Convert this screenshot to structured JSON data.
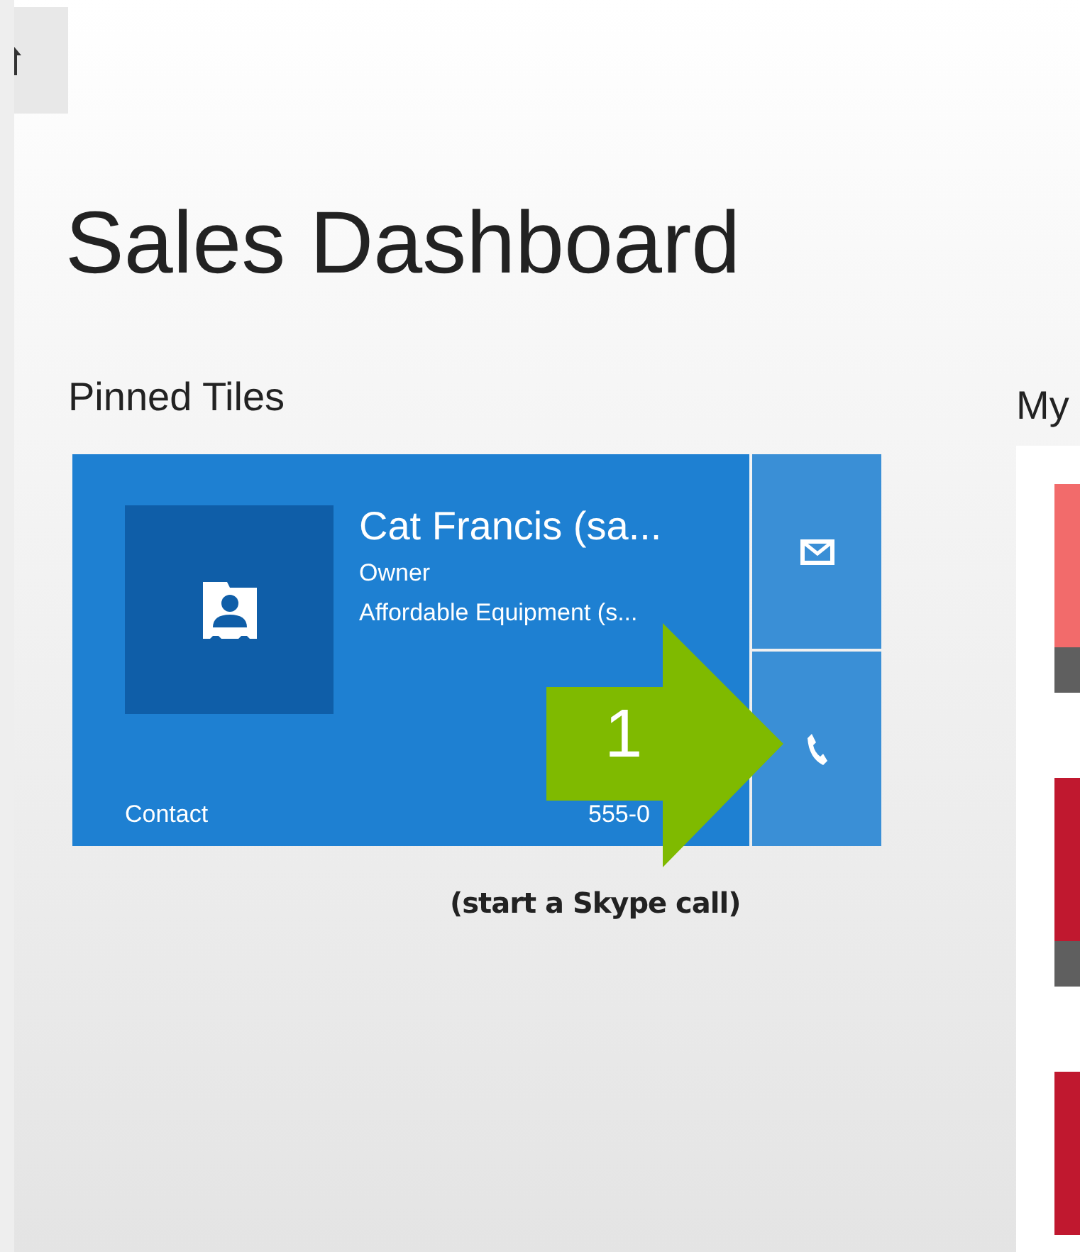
{
  "dashboard": {
    "title": "Sales Dashboard"
  },
  "pinned": {
    "heading": "Pinned Tiles",
    "tile": {
      "name": "Cat Francis (sa...",
      "role": "Owner",
      "company": "Affordable Equipment (s...",
      "type": "Contact",
      "phone": "555-0"
    }
  },
  "callout": {
    "number": "1",
    "caption": "(start a Skype call)"
  },
  "my_section": {
    "heading": "My",
    "tiles": [
      {
        "color": "#f26b6b",
        "footer": true
      },
      {
        "color": "#c0182f",
        "footer": true
      },
      {
        "color": "#c0182f"
      }
    ]
  }
}
